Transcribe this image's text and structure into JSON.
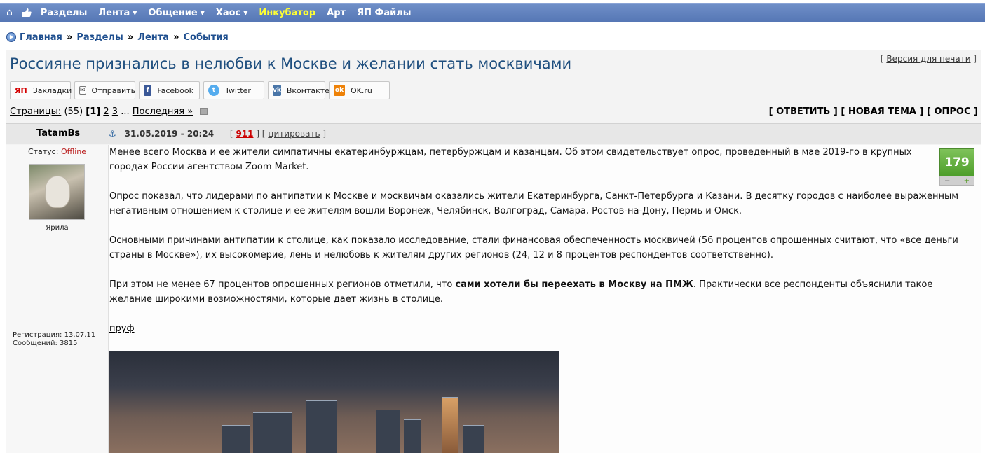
{
  "nav": {
    "items": [
      {
        "label": "Разделы",
        "caret": false,
        "highlight": false
      },
      {
        "label": "Лента",
        "caret": true,
        "highlight": false
      },
      {
        "label": "Общение",
        "caret": true,
        "highlight": false
      },
      {
        "label": "Хаос",
        "caret": true,
        "highlight": false
      },
      {
        "label": "Инкубатор",
        "caret": false,
        "highlight": true
      },
      {
        "label": "Арт",
        "caret": false,
        "highlight": false
      },
      {
        "label": "ЯП Файлы",
        "caret": false,
        "highlight": false
      }
    ],
    "highlight_color": "#ffff33",
    "bar_color": "#5f80bd"
  },
  "breadcrumb": [
    "Главная",
    "Разделы",
    "Лента",
    "События"
  ],
  "topic": {
    "title": "Россияне признались в нелюбви к Москве и желании стать москвичами",
    "print_link": "Версия для печати"
  },
  "share": [
    {
      "label": "Закладки",
      "icon": "yap-icon",
      "glyph": "ЯП"
    },
    {
      "label": "Отправить",
      "icon": "mail-icon",
      "glyph": "✉"
    },
    {
      "label": "Facebook",
      "icon": "facebook-icon",
      "glyph": "f"
    },
    {
      "label": "Twitter",
      "icon": "twitter-icon",
      "glyph": "t"
    },
    {
      "label": "Вконтакте",
      "icon": "vk-icon",
      "glyph": "vk"
    },
    {
      "label": "OK.ru",
      "icon": "ok-icon",
      "glyph": "ok"
    }
  ],
  "pager": {
    "label": "Страницы:",
    "count": "(55)",
    "current": "[1]",
    "pages": [
      "2",
      "3"
    ],
    "ellipsis": "...",
    "last": "Последняя »"
  },
  "actions": {
    "reply": "ОТВЕТИТЬ",
    "new_topic": "НОВАЯ ТЕМА",
    "poll": "ОПРОС"
  },
  "post": {
    "author": "TatamBs",
    "status_label": "Статус:",
    "status_value": "Offline",
    "avatar_caption": "Ярила",
    "registration": "Регистрация: 13.07.11",
    "messages": "Сообщений: 3815",
    "date": "31.05.2019 - 20:24",
    "number": "911",
    "quote_label": "цитировать",
    "rating": "179",
    "paragraphs": [
      "Менее всего Москва и ее жители симпатичны екатеринбуржцам, петербуржцам и казанцам. Об этом свидетельствует опрос, проведенный в мае 2019-го в крупных городах России агентством Zoom Market.",
      "Опрос показал, что лидерами по антипатии к Москве и москвичам оказались жители Екатеринбурга, Санкт-Петербурга и Казани. В десятку городов с наиболее выраженным негативным отношением к столице и ее жителям вошли Воронеж, Челябинск, Волгоград, Самара, Ростов-на-Дону, Пермь и Омск.",
      "Основными причинами антипатии к столице, как показало исследование, стали финансовая обеспеченность москвичей (56 процентов опрошенных считают, что «все деньги страны в Москве»), их высокомерие, лень и нелюбовь к жителям других регионов (24, 12 и 8 процентов респондентов соответственно)."
    ],
    "p4_before": "При этом не менее 67 процентов опрошенных регионов отметили, что ",
    "p4_bold": "сами хотели бы переехать в Москву на ПМЖ",
    "p4_after": ". Практически все респонденты объяснили такое желание широкими возможностями, которые дает жизнь в столице.",
    "source_link": "пруф"
  }
}
